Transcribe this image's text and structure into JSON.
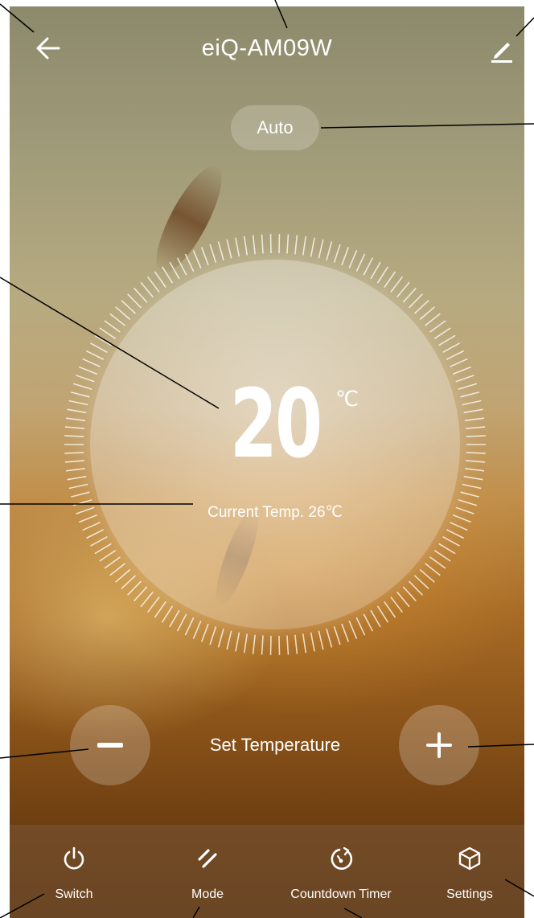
{
  "header": {
    "title": "eiQ-AM09W",
    "back_icon": "arrow-left-icon",
    "edit_icon": "pencil-icon"
  },
  "mode_pill": {
    "label": "Auto"
  },
  "thermostat": {
    "set_value": "20",
    "unit": "℃",
    "current_temp_text": "Current Temp. 26℃"
  },
  "controls": {
    "decrease_icon": "minus-icon",
    "increase_icon": "plus-icon",
    "set_label": "Set Temperature"
  },
  "bottom_nav": {
    "items": [
      {
        "label": "Switch",
        "icon": "power-icon"
      },
      {
        "label": "Mode",
        "icon": "mode-slashes-icon"
      },
      {
        "label": "Countdown Timer",
        "icon": "timer-icon"
      },
      {
        "label": "Settings",
        "icon": "cube-icon"
      }
    ]
  },
  "colors": {
    "foreground": "#ffffff",
    "annotation_line": "#000000"
  }
}
